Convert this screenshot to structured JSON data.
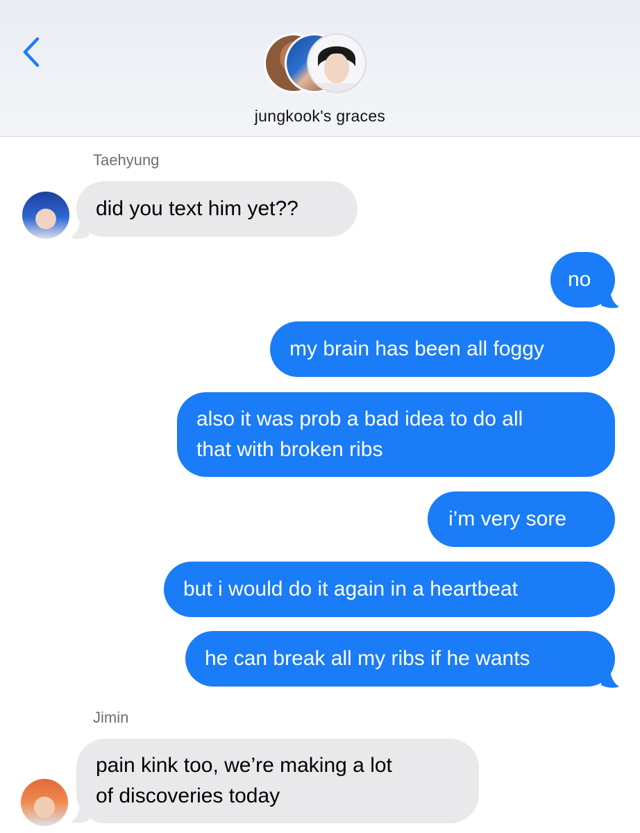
{
  "header": {
    "group_name": "jungkook's graces",
    "back_icon": "chevron-left-icon",
    "accent_color": "#1a7cf6"
  },
  "messages": [
    {
      "sender": "Taehyung",
      "direction": "incoming",
      "text": "did you text him yet??"
    },
    {
      "direction": "outgoing",
      "text": "no"
    },
    {
      "direction": "outgoing",
      "text": "my brain has been all foggy"
    },
    {
      "direction": "outgoing",
      "lines": [
        "also it was prob a bad idea to do all",
        "that with broken ribs"
      ]
    },
    {
      "direction": "outgoing",
      "text": "i’m very sore"
    },
    {
      "direction": "outgoing",
      "text": "but i would do it again in a heartbeat"
    },
    {
      "direction": "outgoing",
      "text": "he can break all my ribs if he wants"
    },
    {
      "sender": "Jimin",
      "direction": "incoming",
      "lines": [
        "pain kink too, we’re making a lot",
        "of discoveries today"
      ]
    }
  ],
  "colors": {
    "incoming_bubble": "#e9e9eb",
    "outgoing_bubble": "#1a7cf6",
    "sender_name": "#6e6e73"
  }
}
